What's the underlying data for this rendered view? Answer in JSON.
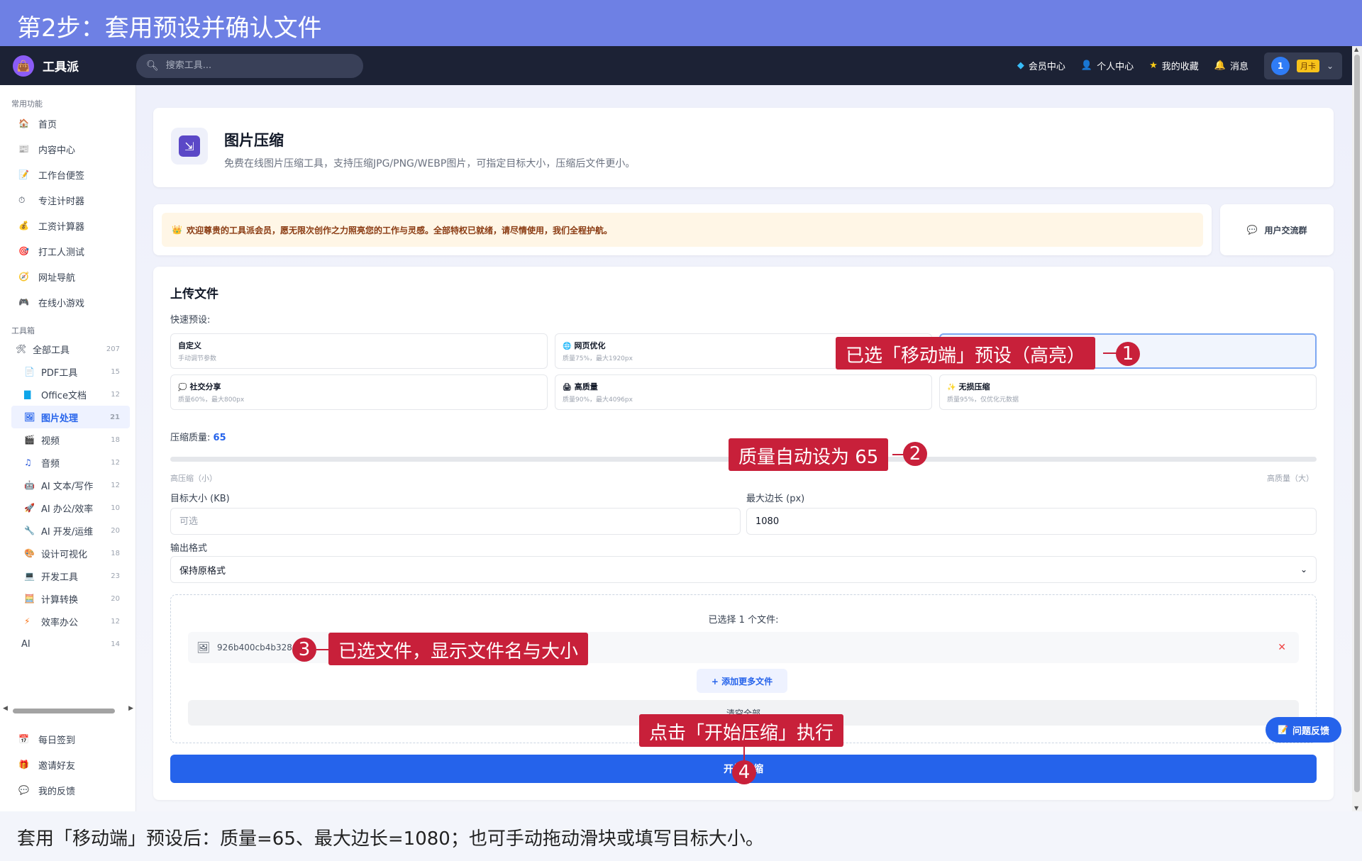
{
  "tutorial": {
    "step_title": "第2步：套用预设并确认文件",
    "caption": "套用「移动端」预设后：质量=65、最大边长=1080；也可手动拖动滑块或填写目标大小。",
    "callouts": [
      {
        "number": "1",
        "text": "已选「移动端」预设（高亮）"
      },
      {
        "number": "2",
        "text": "质量自动设为 65"
      },
      {
        "number": "3",
        "text": "已选文件，显示文件名与大小"
      },
      {
        "number": "4",
        "text": "点击「开始压缩」执行"
      }
    ]
  },
  "header": {
    "logo_text": "工具派",
    "search_placeholder": "搜索工具...",
    "links": [
      {
        "label": "会员中心",
        "icon": "diamond-icon"
      },
      {
        "label": "个人中心",
        "icon": "user-icon"
      },
      {
        "label": "我的收藏",
        "icon": "star-icon"
      },
      {
        "label": "消息",
        "icon": "bell-icon"
      }
    ],
    "user": {
      "badge": "1",
      "vip": "月卡"
    }
  },
  "sidebar": {
    "common_title": "常用功能",
    "common_items": [
      {
        "label": "首页",
        "icon": "home-icon"
      },
      {
        "label": "内容中心",
        "icon": "news-icon"
      },
      {
        "label": "工作台便签",
        "icon": "memo-icon"
      },
      {
        "label": "专注计时器",
        "icon": "timer-icon"
      },
      {
        "label": "工资计算器",
        "icon": "money-bag-icon"
      },
      {
        "label": "打工人测试",
        "icon": "target-icon"
      },
      {
        "label": "网址导航",
        "icon": "compass-icon"
      },
      {
        "label": "在线小游戏",
        "icon": "gamepad-icon"
      }
    ],
    "toolbox_title": "工具箱",
    "all_tools": {
      "label": "全部工具",
      "count": "207"
    },
    "categories": [
      {
        "label": "PDF工具",
        "count": "15",
        "icon": "pdf-icon"
      },
      {
        "label": "Office文档",
        "count": "12",
        "icon": "office-icon"
      },
      {
        "label": "图片处理",
        "count": "21",
        "icon": "image-icon",
        "active": true
      },
      {
        "label": "视频",
        "count": "18",
        "icon": "clapper-icon"
      },
      {
        "label": "音频",
        "count": "12",
        "icon": "music-icon"
      },
      {
        "label": "AI 文本/写作",
        "count": "12",
        "icon": "robot-icon"
      },
      {
        "label": "AI 办公/效率",
        "count": "10",
        "icon": "rocket-icon"
      },
      {
        "label": "AI 开发/运维",
        "count": "20",
        "icon": "wrench-icon"
      },
      {
        "label": "设计可视化",
        "count": "18",
        "icon": "palette-icon"
      },
      {
        "label": "开发工具",
        "count": "23",
        "icon": "laptop-icon"
      },
      {
        "label": "计算转换",
        "count": "20",
        "icon": "calculator-icon"
      },
      {
        "label": "效率办公",
        "count": "12",
        "icon": "lightning-icon"
      },
      {
        "label": "AI",
        "count": "14",
        "icon": ""
      }
    ],
    "bottom_items": [
      {
        "label": "每日签到",
        "icon": "calendar-icon"
      },
      {
        "label": "邀请好友",
        "icon": "gift-icon"
      },
      {
        "label": "我的反馈",
        "icon": "chat-icon"
      }
    ]
  },
  "tool": {
    "title": "图片压缩",
    "description": "免费在线图片压缩工具，支持压缩JPG/PNG/WEBP图片，可指定目标大小，压缩后文件更小。"
  },
  "welcome": {
    "message": "欢迎尊贵的工具派会员，愿无限次创作之力照亮您的工作与灵感。全部特权已就绪，请尽情使用，我们全程护航。",
    "group_button": "用户交流群"
  },
  "upload": {
    "title": "上传文件",
    "presets_label": "快速预设:",
    "presets": [
      {
        "name": "自定义",
        "desc": "手动调节参数",
        "icon": ""
      },
      {
        "name": "网页优化",
        "desc": "质量75%，最大1920px",
        "icon": "globe-icon"
      },
      {
        "name": "",
        "desc": "",
        "icon": "",
        "selected": true
      },
      {
        "name": "社交分享",
        "desc": "质量60%，最大800px",
        "icon": "speech-icon"
      },
      {
        "name": "高质量",
        "desc": "质量90%，最大4096px",
        "icon": "printer-icon"
      },
      {
        "name": "无损压缩",
        "desc": "质量95%，仅优化元数据",
        "icon": "sparkle-icon"
      }
    ],
    "quality_label": "压缩质量:",
    "quality_value": "65",
    "quality_fraction": 0.65,
    "slider_left_hint": "高压缩（小）",
    "slider_right_hint": "高质量（大）",
    "target_size_label": "目标大小 (KB)",
    "target_size_placeholder": "可选",
    "max_edge_label": "最大边长 (px)",
    "max_edge_value": "1080",
    "format_label": "输出格式",
    "format_value": "保持原格式",
    "selected_count_text": "已选择 1 个文件:",
    "file_name": "926b400cb4b328",
    "add_more": "+ 添加更多文件",
    "clear_all": "清空全部",
    "start_button": "开始压缩"
  },
  "feedback_button": "问题反馈"
}
